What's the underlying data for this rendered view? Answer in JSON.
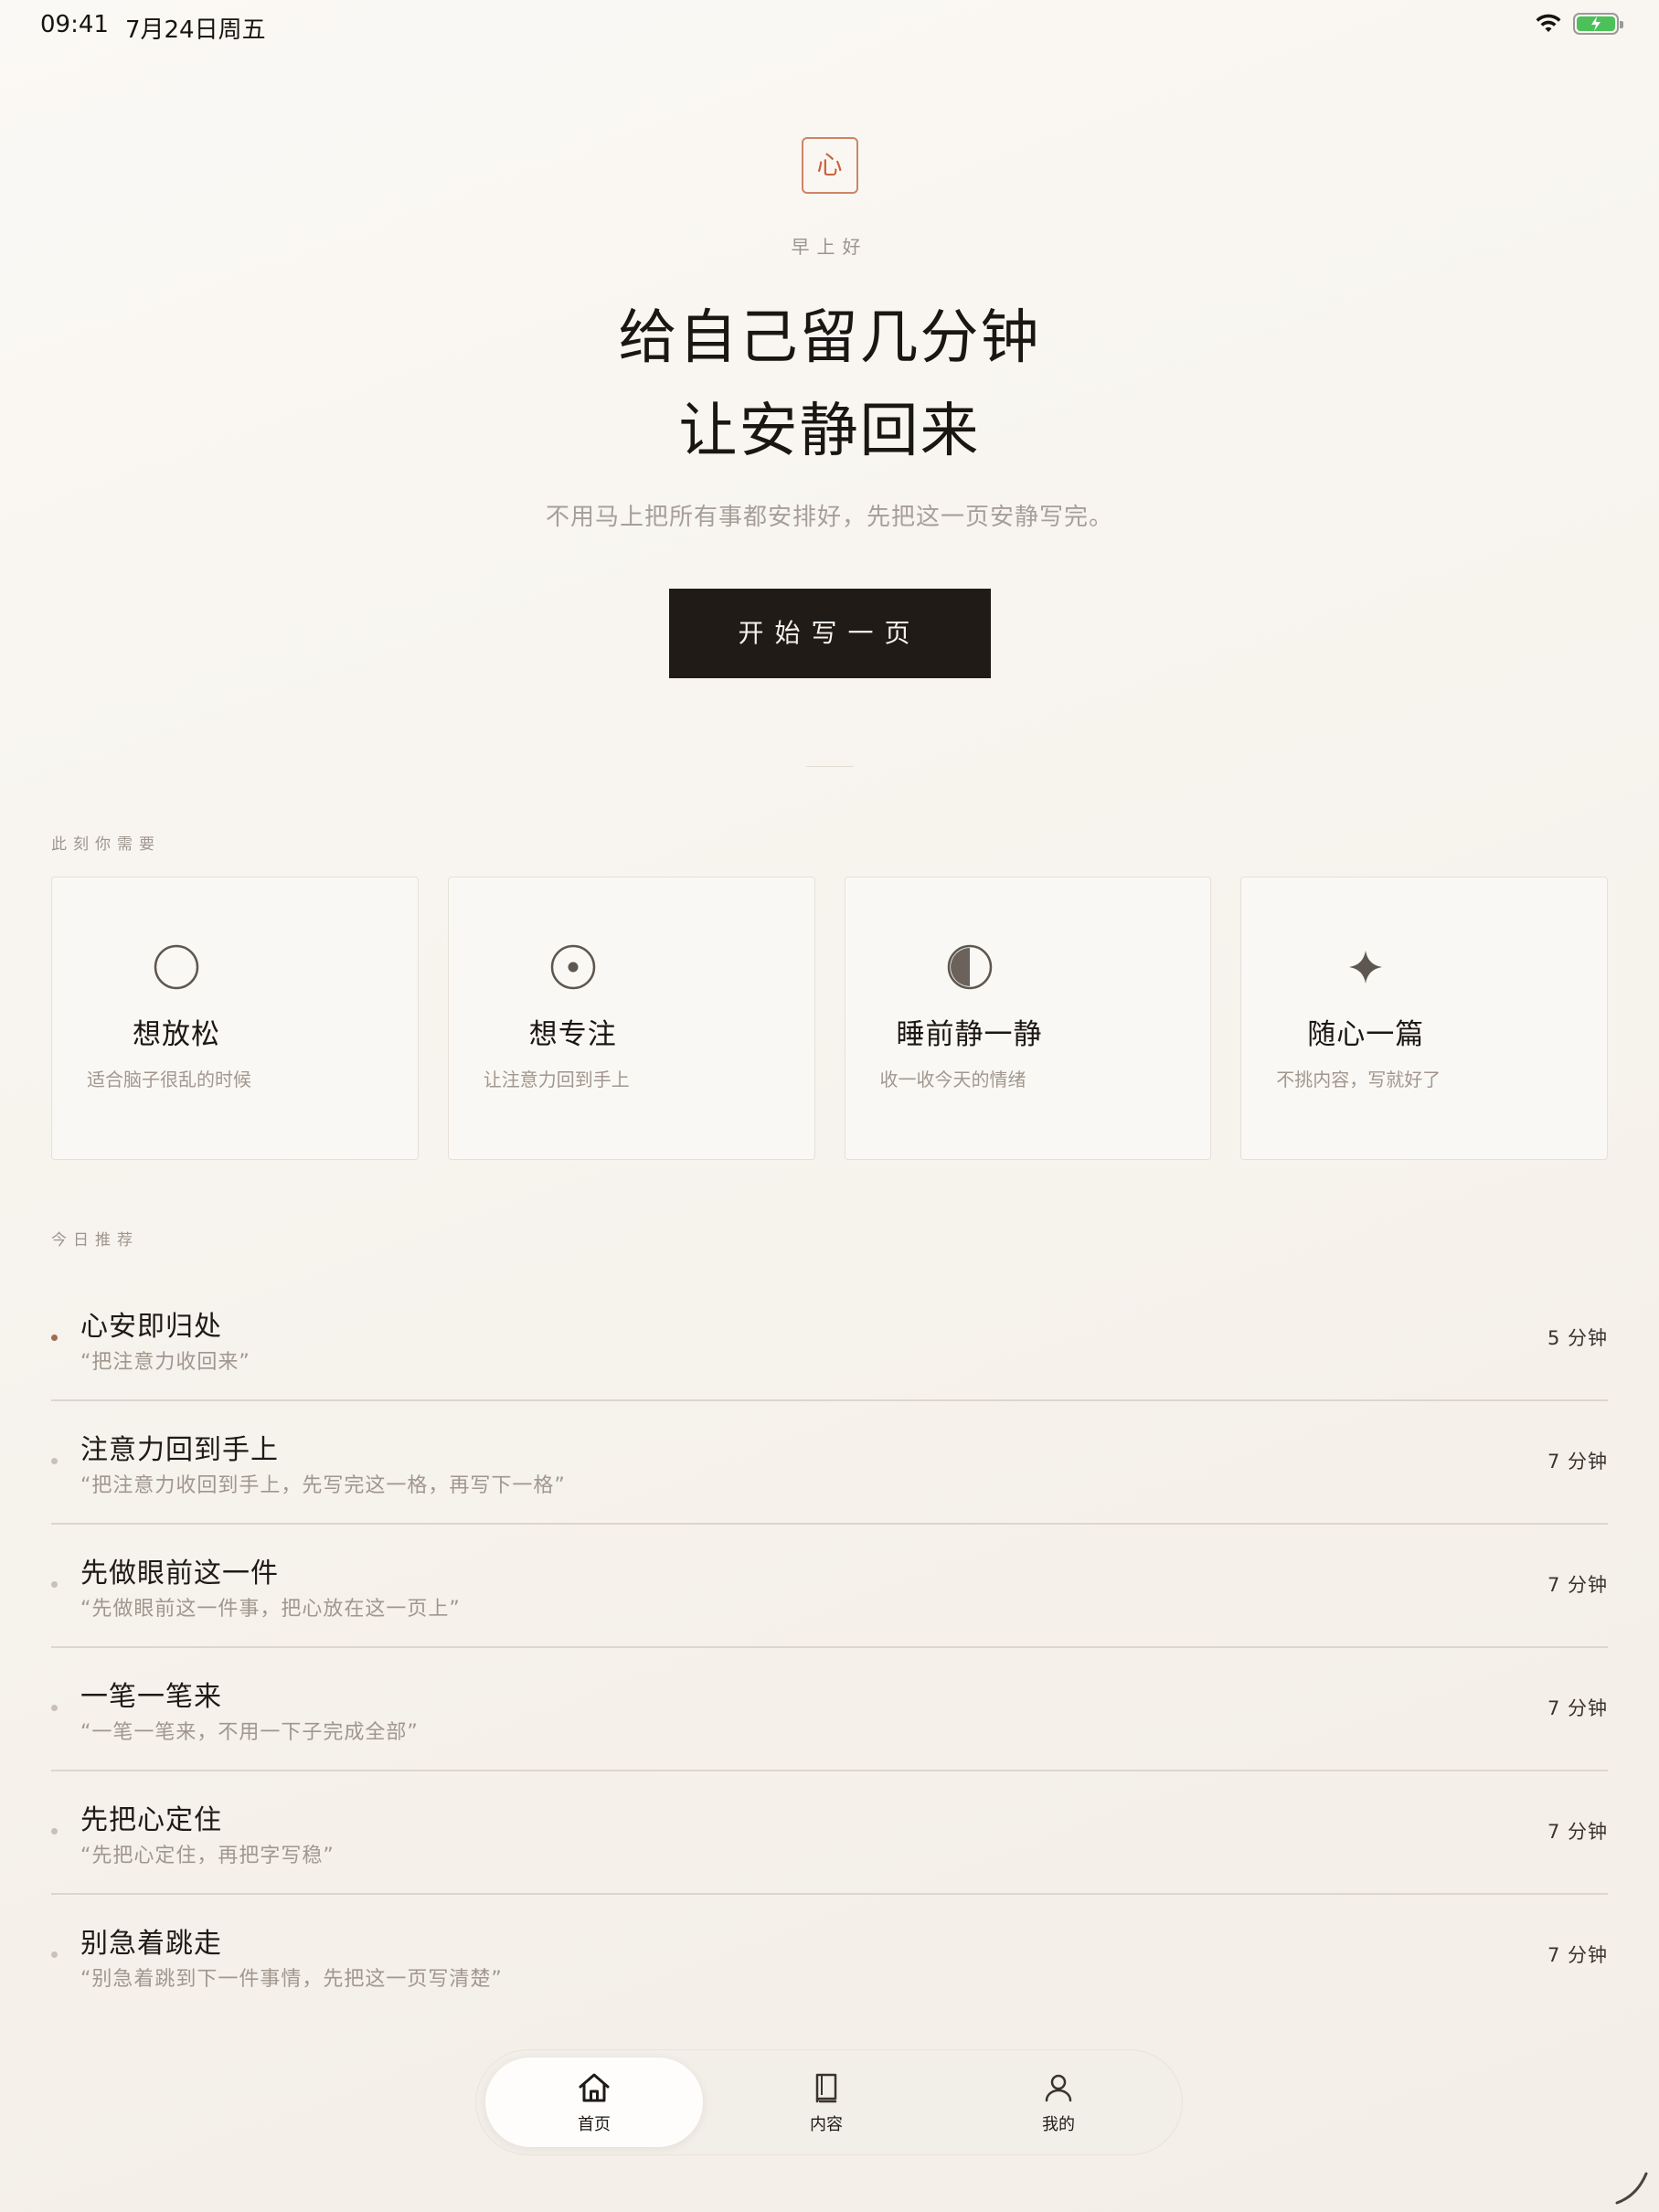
{
  "status_bar": {
    "time": "09:41",
    "date": "7月24日周五",
    "battery_percent": 100,
    "battery_color": "#4cc15a"
  },
  "hero": {
    "logo_glyph": "心",
    "greeting": "早上好",
    "headline_line1": "给自己留几分钟",
    "headline_line2": "让安静回来",
    "subline": "不用马上把所有事都安排好，先把这一页安静写完。",
    "cta_label": "开始写一页"
  },
  "moods": {
    "section_label": "此刻你需要",
    "items": [
      {
        "icon": "circle-icon",
        "title": "想放松",
        "desc": "适合脑子很乱的时候"
      },
      {
        "icon": "target-icon",
        "title": "想专注",
        "desc": "让注意力回到手上"
      },
      {
        "icon": "half-moon-icon",
        "title": "睡前静一静",
        "desc": "收一收今天的情绪"
      },
      {
        "icon": "sparkle-icon",
        "title": "随心一篇",
        "desc": "不挑内容，写就好了"
      }
    ]
  },
  "recommendations": {
    "section_label": "今日推荐",
    "items": [
      {
        "title": "心安即归处",
        "quote": "“把注意力收回来”",
        "duration": "5 分钟",
        "active": true
      },
      {
        "title": "注意力回到手上",
        "quote": "“把注意力收回到手上，先写完这一格，再写下一格”",
        "duration": "7 分钟",
        "active": false
      },
      {
        "title": "先做眼前这一件",
        "quote": "“先做眼前这一件事，把心放在这一页上”",
        "duration": "7 分钟",
        "active": false
      },
      {
        "title": "一笔一笔来",
        "quote": "“一笔一笔来，不用一下子完成全部”",
        "duration": "7 分钟",
        "active": false
      },
      {
        "title": "先把心定住",
        "quote": "“先把心定住，再把字写稳”",
        "duration": "7 分钟",
        "active": false
      },
      {
        "title": "别急着跳走",
        "quote": "“别急着跳到下一件事情，先把这一页写清楚”",
        "duration": "7 分钟",
        "active": false
      }
    ]
  },
  "tab_bar": {
    "tabs": [
      {
        "label": "首页",
        "icon": "home-icon",
        "active": true
      },
      {
        "label": "内容",
        "icon": "book-icon",
        "active": false
      },
      {
        "label": "我的",
        "icon": "user-icon",
        "active": false
      }
    ]
  },
  "colors": {
    "accent": "#c9603f",
    "cta_background": "#211b18",
    "background": "#f7f3ee"
  }
}
